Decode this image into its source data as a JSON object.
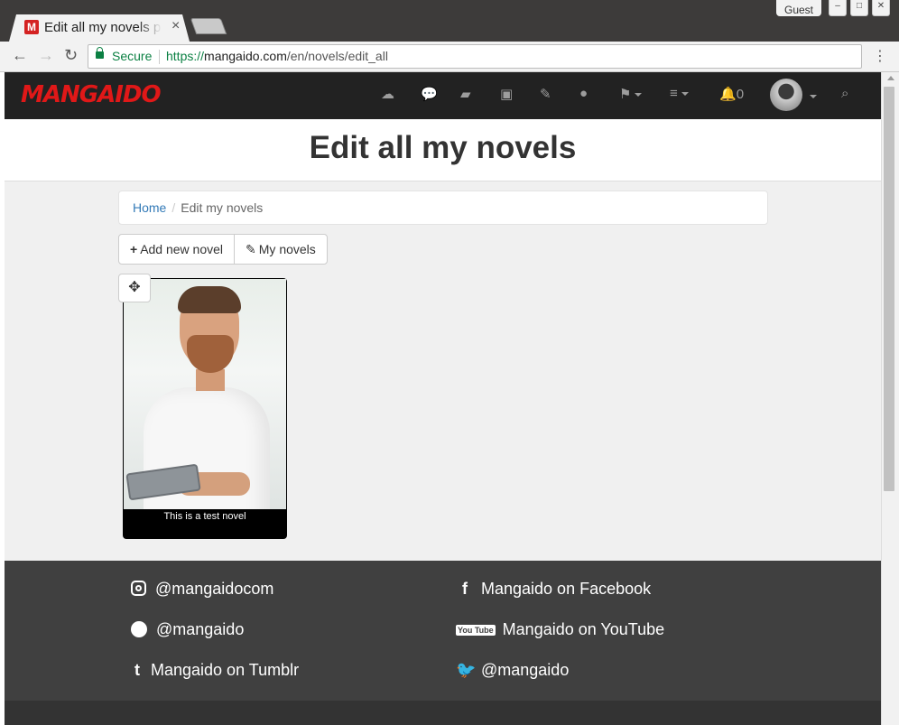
{
  "browser": {
    "guest_label": "Guest",
    "tab_title": "Edit all my novels p",
    "tab_favicon": "M",
    "secure_label": "Secure",
    "url_scheme": "https://",
    "url_host": "mangaido.com",
    "url_path": "/en/novels/edit_all"
  },
  "navbar": {
    "logo": "MANGAIDO",
    "icons": [
      "upload-cloud-icon",
      "comments-icon",
      "book-icon",
      "image-icon",
      "edit-icon",
      "apple-icon",
      "flag-icon",
      "menu-icon",
      "bell-icon",
      "search-icon"
    ],
    "notification_count": "0"
  },
  "page": {
    "title": "Edit all my novels"
  },
  "breadcrumb": {
    "home": "Home",
    "current": "Edit my novels"
  },
  "actions": {
    "add_new": "Add new novel",
    "my_novels": "My novels"
  },
  "novels": [
    {
      "caption": "This is a test novel"
    }
  ],
  "footer": {
    "instagram": "@mangaidocom",
    "facebook": "Mangaido on Facebook",
    "snapchat": "@mangaido",
    "youtube": "Mangaido on YouTube",
    "youtube_icon_text": "You Tube",
    "tumblr": "Mangaido on Tumblr",
    "twitter": "@mangaido"
  },
  "colors": {
    "brand": "#e01818",
    "navbar": "#222222",
    "footer": "#404040",
    "link": "#337ab7"
  }
}
